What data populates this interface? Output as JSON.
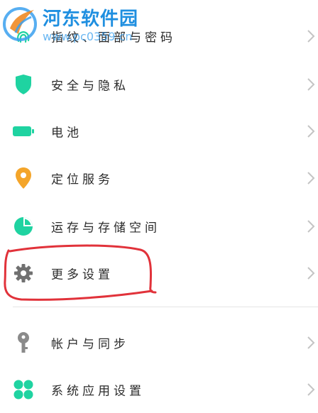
{
  "settings": {
    "items": [
      {
        "label": "指纹、面部与密码",
        "icon": "fingerprint-icon"
      },
      {
        "label": "安全与隐私",
        "icon": "shield-icon",
        "color": "#1fd3a1"
      },
      {
        "label": "电池",
        "icon": "battery-icon",
        "color": "#1fd3a1"
      },
      {
        "label": "定位服务",
        "icon": "location-pin-icon",
        "color": "#f4a52a"
      },
      {
        "label": "运存与存储空间",
        "icon": "storage-pie-icon",
        "color": "#1fd3a1"
      },
      {
        "label": "更多设置",
        "icon": "gear-icon",
        "color": "#707070"
      },
      {
        "label": "帐户与同步",
        "icon": "key-icon",
        "color": "#8a8a8a"
      },
      {
        "label": "系统应用设置",
        "icon": "apps-grid-icon",
        "color": "#1fd3a1"
      }
    ]
  },
  "watermark": {
    "brand": "河东软件园",
    "url": "www.pc0359.cn"
  },
  "colors": {
    "annotation": "#e1323a",
    "chevron": "#c4c4c4",
    "text": "#2b2b2b"
  }
}
